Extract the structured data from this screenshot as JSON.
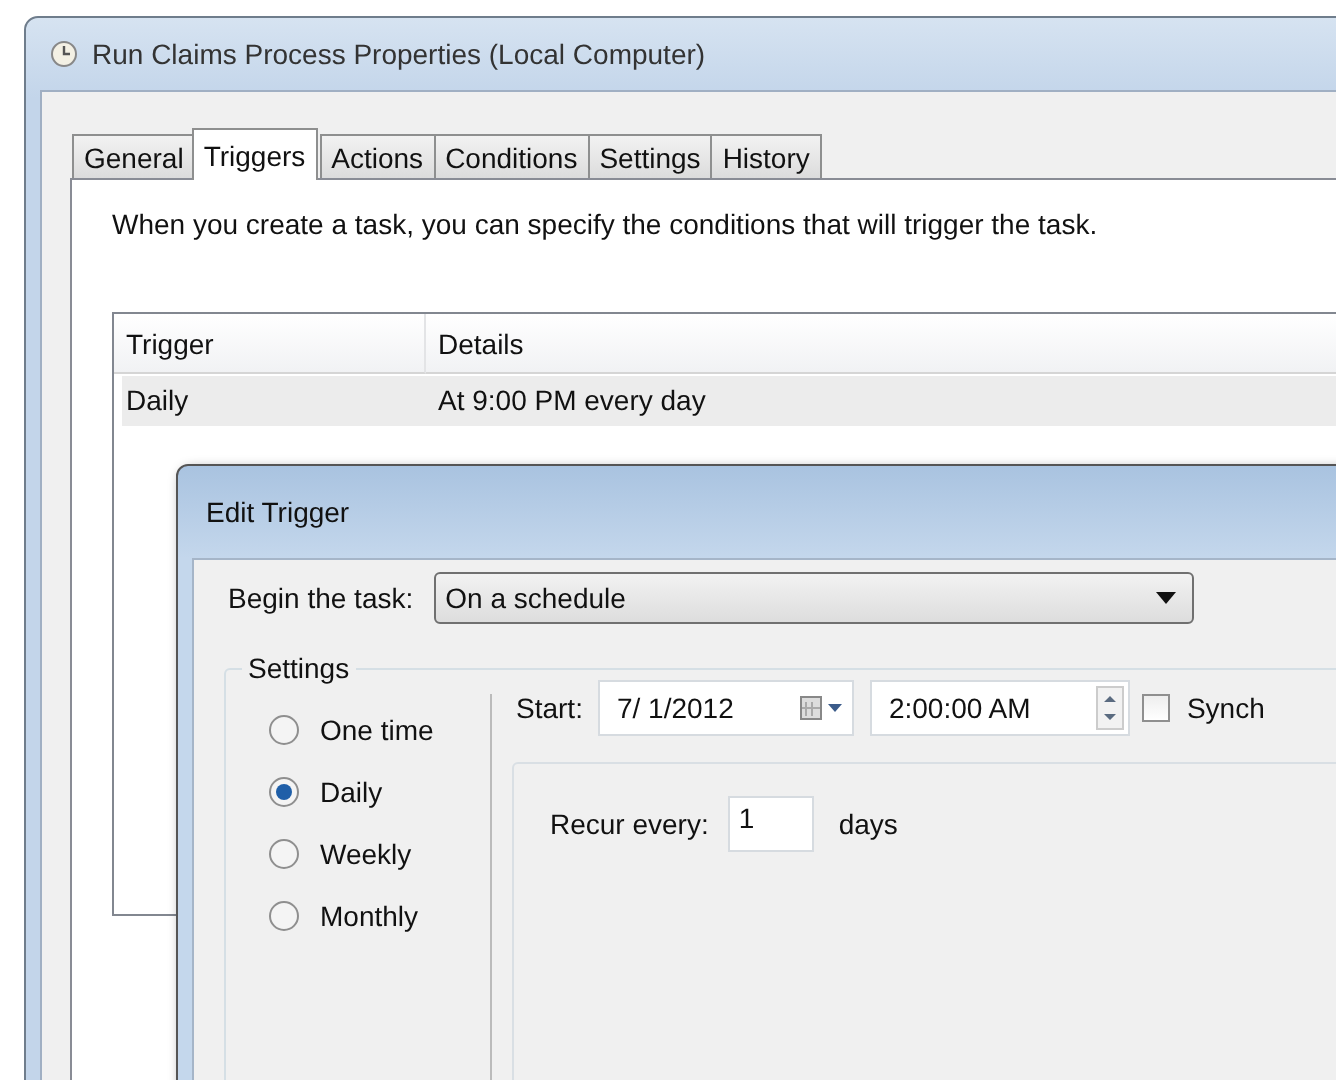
{
  "window": {
    "title": "Run Claims Process Properties (Local Computer)"
  },
  "tabs": [
    {
      "label": "General",
      "selected": false
    },
    {
      "label": "Triggers",
      "selected": true
    },
    {
      "label": "Actions",
      "selected": false
    },
    {
      "label": "Conditions",
      "selected": false
    },
    {
      "label": "Settings",
      "selected": false
    },
    {
      "label": "History",
      "selected": false
    }
  ],
  "description": "When you create a task, you can specify the conditions that will trigger the task.",
  "table": {
    "columns": [
      "Trigger",
      "Details"
    ],
    "rows": [
      {
        "cells": [
          "Daily",
          "At 9:00 PM every day"
        ],
        "selected": true
      }
    ]
  },
  "dialog": {
    "title": "Edit Trigger",
    "begin_label": "Begin the task:",
    "begin_value": "On a schedule",
    "settings_label": "Settings",
    "schedule_options": [
      {
        "label": "One time",
        "selected": false
      },
      {
        "label": "Daily",
        "selected": true
      },
      {
        "label": "Weekly",
        "selected": false
      },
      {
        "label": "Monthly",
        "selected": false
      }
    ],
    "start_label": "Start:",
    "start_date": "7/ 1/2012",
    "start_time": "2:00:00 AM",
    "sync": {
      "label": "Synch",
      "checked": false
    },
    "recur_label": "Recur every:",
    "recur_value": "1",
    "recur_unit": "days"
  }
}
